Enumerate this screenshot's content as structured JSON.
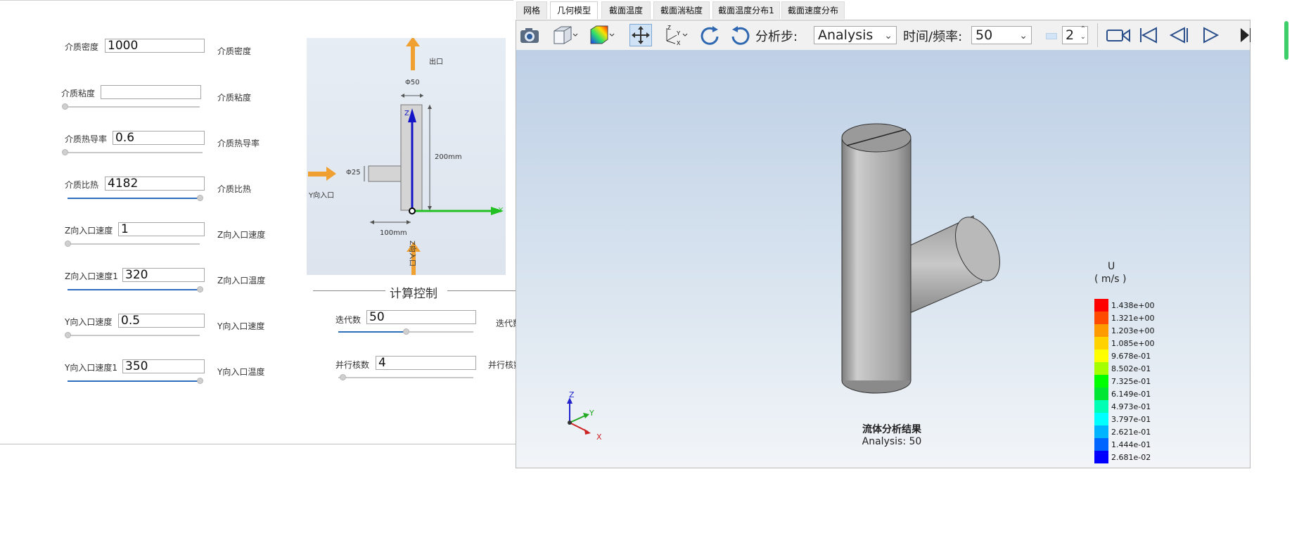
{
  "form": {
    "rows": [
      {
        "label": "介质密度",
        "value": "1000",
        "right": "介质密度",
        "slider": null
      },
      {
        "label": "介质粘度",
        "value": "",
        "right": "介质粘度",
        "slider": 0.0
      },
      {
        "label": "介质热导率",
        "value": "0.6",
        "right": "介质热导率",
        "slider": 0.0
      },
      {
        "label": "介质比热",
        "value": "4182",
        "right": "介质比热",
        "slider": 1.0
      },
      {
        "label": "Z向入口速度",
        "value": "1",
        "right": "Z向入口速度",
        "slider": 0.0
      },
      {
        "label": "Z向入口速度1",
        "value": "320",
        "right": "Z向入口温度",
        "slider": 1.0
      },
      {
        "label": "Y向入口速度",
        "value": "0.5",
        "right": "Y向入口速度",
        "slider": 0.0
      },
      {
        "label": "Y向入口速度1",
        "value": "350",
        "right": "Y向入口温度",
        "slider": 1.0
      }
    ]
  },
  "diagram": {
    "outlet": "出口",
    "phi50": "Φ50",
    "phi25": "Φ25",
    "height": "200mm",
    "width": "100mm",
    "y_inlet": "Y向入口",
    "z_inlet": "Z向入口",
    "axis_z": "Z",
    "axis_y": "Y"
  },
  "calc": {
    "title": "计算控制",
    "iterations_label": "迭代数",
    "iterations_value": "50",
    "iterations_right": "迭代数",
    "iterations_slider": 0.5,
    "cores_label": "并行核数",
    "cores_value": "4",
    "cores_right": "并行核数",
    "cores_slider": 0.0
  },
  "tabs": [
    {
      "label": "网格",
      "active": false
    },
    {
      "label": "几何模型",
      "active": true
    },
    {
      "label": "截面温度",
      "active": false
    },
    {
      "label": "截面湍粘度",
      "active": false
    },
    {
      "label": "截面温度分布1",
      "active": false
    },
    {
      "label": "截面速度分布",
      "active": false
    }
  ],
  "toolbar": {
    "icons": [
      "camera-icon",
      "cube-view-icon",
      "color-map-icon",
      "pan-icon",
      "axes-icon",
      "rotate-cw-icon",
      "rotate-ccw-icon",
      "record-icon",
      "first-frame-icon",
      "prev-frame-icon",
      "play-icon",
      "last-frame-icon"
    ],
    "step_label": "分析步:",
    "step_value": "Analysis",
    "time_label": "时间/频率:",
    "time_value": "50",
    "spin_value": "2"
  },
  "legend": {
    "title": "U",
    "unit": "( m/s )",
    "entries": [
      {
        "value": "1.438e+00",
        "color": "#ff0000"
      },
      {
        "value": "1.321e+00",
        "color": "#ff4a00"
      },
      {
        "value": "1.203e+00",
        "color": "#ff9a00"
      },
      {
        "value": "1.085e+00",
        "color": "#ffd200"
      },
      {
        "value": "9.678e-01",
        "color": "#ffff00"
      },
      {
        "value": "8.502e-01",
        "color": "#a6ff00"
      },
      {
        "value": "7.325e-01",
        "color": "#00ff00"
      },
      {
        "value": "6.149e-01",
        "color": "#00e632"
      },
      {
        "value": "4.973e-01",
        "color": "#00ffb4"
      },
      {
        "value": "3.797e-01",
        "color": "#00ffff"
      },
      {
        "value": "2.621e-01",
        "color": "#00b4ff"
      },
      {
        "value": "1.444e-01",
        "color": "#0064ff"
      },
      {
        "value": "2.681e-02",
        "color": "#0000ff"
      }
    ]
  },
  "scene": {
    "caption_title": "流体分析结果",
    "caption_sub": "Analysis: 50",
    "axis_z": "Z",
    "axis_y": "Y",
    "axis_x": "X"
  }
}
